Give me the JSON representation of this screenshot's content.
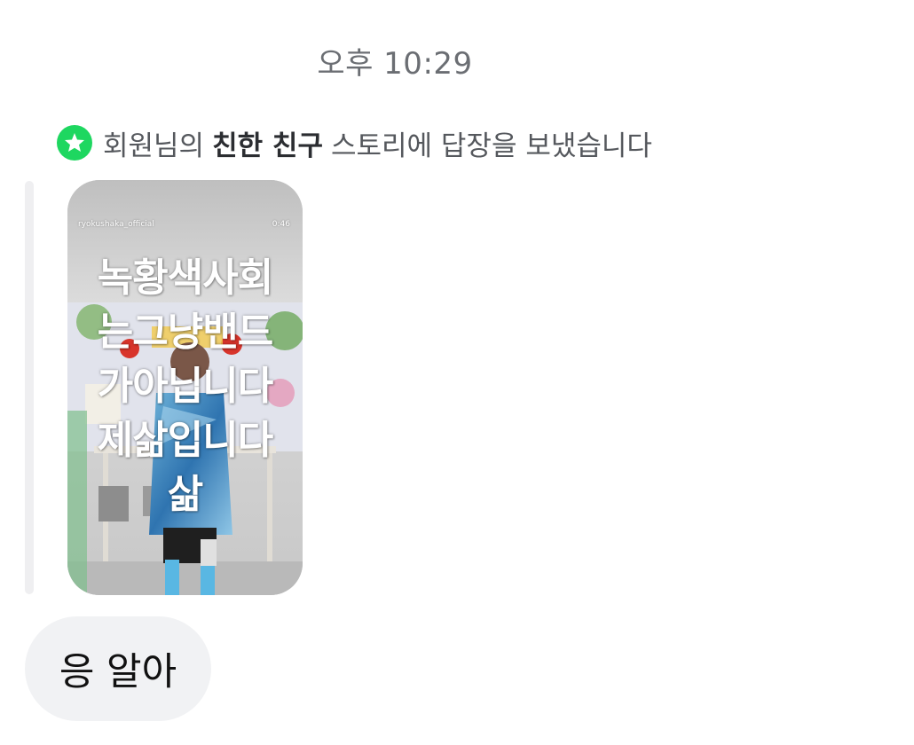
{
  "chat": {
    "timestamp": "오후 10:29",
    "notice": {
      "icon": "star-icon",
      "accent_color": "#1ed760",
      "prefix": "회원님의",
      "bold": "친한 친구",
      "suffix": "스토리에 답장을 보냈습니다"
    },
    "story": {
      "username": "ryokushaka_official",
      "duration": "0:46",
      "caption_lines": [
        "녹황색사회",
        "는그냥밴드",
        "가아닙니다",
        "제삶입니다",
        "삶"
      ]
    },
    "message": {
      "text": "응 알아"
    }
  }
}
